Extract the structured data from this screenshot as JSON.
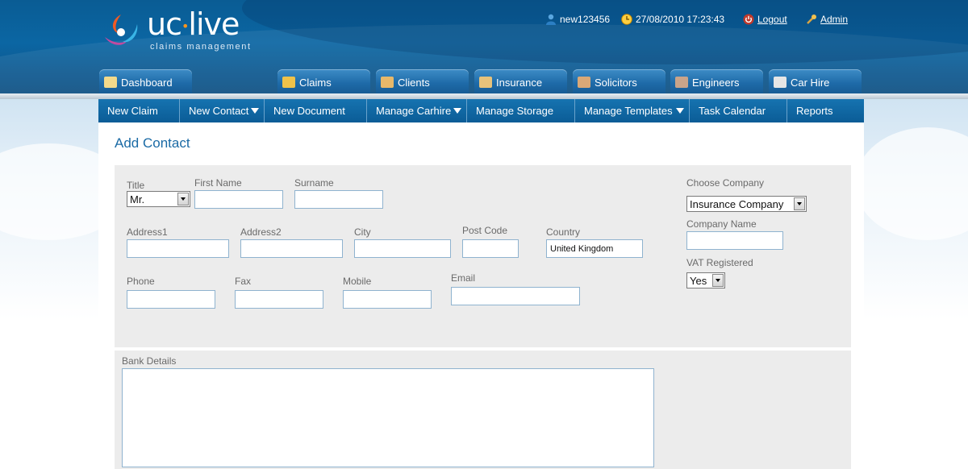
{
  "brand": {
    "logo_main_left": "uc",
    "logo_main_dot": "•",
    "logo_main_right": "live",
    "logo_sub": "claims management"
  },
  "userbar": {
    "username": "new123456",
    "datetime": "27/08/2010 17:23:43",
    "logout": "Logout",
    "admin": "Admin"
  },
  "tabs": [
    {
      "label": "Dashboard"
    },
    {
      "label": "Claims"
    },
    {
      "label": "Clients"
    },
    {
      "label": "Insurance"
    },
    {
      "label": "Solicitors"
    },
    {
      "label": "Engineers"
    },
    {
      "label": "Car Hire"
    }
  ],
  "subnav": [
    {
      "label": "New Claim"
    },
    {
      "label": "New Contact"
    },
    {
      "label": "New Document"
    },
    {
      "label": "Manage Carhire"
    },
    {
      "label": "Manage Storage"
    },
    {
      "label": "Manage Templates"
    },
    {
      "label": "Task Calendar"
    },
    {
      "label": "Reports"
    }
  ],
  "page": {
    "title": "Add Contact"
  },
  "form": {
    "title_label": "Title",
    "title_value": "Mr.",
    "first_name_label": "First Name",
    "surname_label": "Surname",
    "address1_label": "Address1",
    "address2_label": "Address2",
    "city_label": "City",
    "postcode_label": "Post Code",
    "country_label": "Country",
    "country_value": "United Kingdom",
    "phone_label": "Phone",
    "fax_label": "Fax",
    "mobile_label": "Mobile",
    "email_label": "Email",
    "choose_company_label": "Choose Company",
    "choose_company_value": "Insurance Company",
    "company_name_label": "Company Name",
    "vat_label": "VAT Registered",
    "vat_value": "Yes",
    "bank_details_label": "Bank Details"
  },
  "colors": {
    "header": "#0b66a3",
    "nav": "#0f67a4",
    "accent": "#1a6aa5",
    "panel": "#ececec",
    "logo_orange": "#f7941d"
  }
}
